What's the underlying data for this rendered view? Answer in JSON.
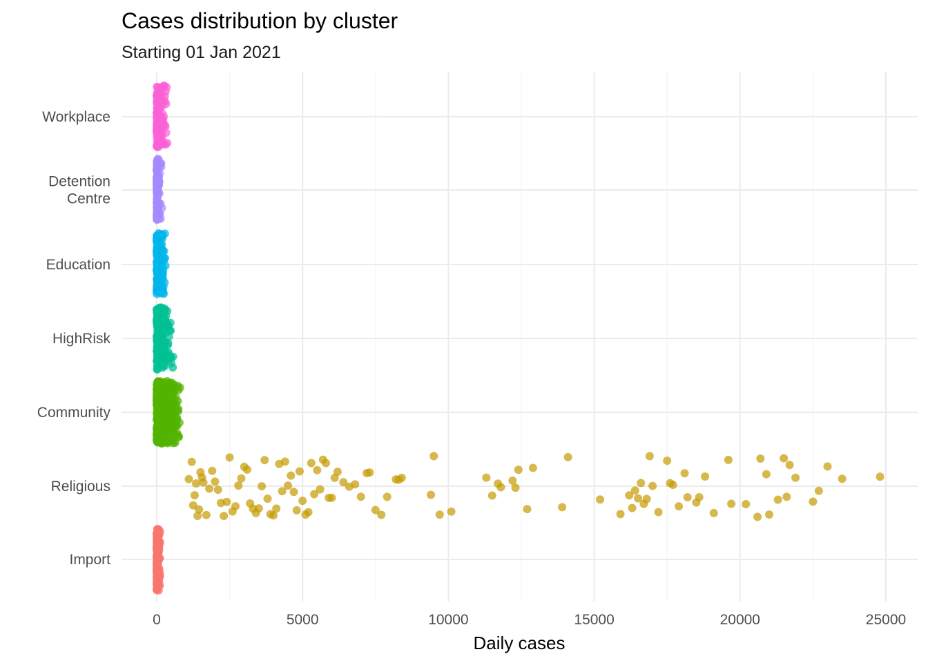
{
  "chart_data": {
    "type": "scatter",
    "subtype": "jitter-strip",
    "title": "Cases distribution by cluster",
    "subtitle": "Starting 01 Jan 2021",
    "xlabel": "Daily cases",
    "ylabel": "",
    "xlim": [
      -1200,
      26000
    ],
    "x_ticks": [
      0,
      5000,
      10000,
      15000,
      20000,
      25000
    ],
    "x_tick_labels": [
      "0",
      "5000",
      "10000",
      "15000",
      "20000",
      "25000"
    ],
    "x_minor_ticks": [
      2500,
      7500,
      12500,
      17500,
      22500
    ],
    "grid": true,
    "legend": "none",
    "categories": [
      "Import",
      "Religious",
      "Community",
      "HighRisk",
      "Education",
      "Detention\nCentre",
      "Workplace"
    ],
    "category_labels": [
      [
        "Import"
      ],
      [
        "Religious"
      ],
      [
        "Community"
      ],
      [
        "HighRisk"
      ],
      [
        "Education"
      ],
      [
        "Detention",
        "Centre"
      ],
      [
        "Workplace"
      ]
    ],
    "colors": {
      "Import": "#F8766D",
      "Religious": "#C49A00",
      "Community": "#53B400",
      "HighRisk": "#00C094",
      "Education": "#00B6EB",
      "Detention\nCentre": "#A58AFF",
      "Workplace": "#FB61D7"
    },
    "series": [
      {
        "name": "Import",
        "values": [
          0,
          5,
          10,
          15,
          20,
          30,
          40,
          50,
          60,
          70,
          80,
          90,
          100,
          110,
          120,
          2,
          8,
          25,
          35,
          45,
          55,
          65,
          75,
          85,
          95,
          105,
          115,
          12,
          18,
          28
        ]
      },
      {
        "name": "Detention\nCentre",
        "values": [
          0,
          0,
          5,
          10,
          15,
          20,
          25,
          30,
          40,
          50,
          60,
          70,
          80,
          90,
          100,
          110,
          120,
          150,
          180,
          3,
          7,
          12
        ]
      },
      {
        "name": "Education",
        "values": [
          0,
          20,
          40,
          60,
          80,
          100,
          120,
          140,
          160,
          180,
          200,
          220,
          240,
          260,
          280,
          300,
          10,
          30,
          50,
          70,
          90,
          110,
          130,
          150,
          170,
          190,
          210,
          230,
          250,
          270
        ]
      },
      {
        "name": "HighRisk",
        "values": [
          0,
          30,
          60,
          90,
          120,
          150,
          180,
          210,
          240,
          270,
          300,
          330,
          360,
          400,
          450,
          500,
          560,
          15,
          45,
          75,
          105,
          135,
          165,
          195,
          225,
          255,
          285,
          315,
          345,
          380,
          420,
          470
        ]
      },
      {
        "name": "Community",
        "values": [
          0,
          40,
          80,
          120,
          160,
          200,
          240,
          280,
          320,
          360,
          400,
          440,
          480,
          520,
          560,
          600,
          640,
          680,
          720,
          760,
          800,
          20,
          60,
          100,
          140,
          180,
          220,
          260,
          300,
          340,
          380,
          420,
          460,
          500,
          540,
          580,
          620,
          660,
          700,
          740,
          780,
          50,
          150,
          250,
          350,
          450,
          550,
          650,
          750,
          90,
          190,
          290,
          390,
          490,
          590,
          690
        ]
      },
      {
        "name": "Religious",
        "values": [
          1100,
          1200,
          1250,
          1300,
          1350,
          1400,
          1450,
          1500,
          1550,
          1600,
          1700,
          1800,
          1900,
          2000,
          2100,
          2200,
          2300,
          2400,
          2500,
          2600,
          2700,
          2800,
          2900,
          3000,
          3100,
          3200,
          3300,
          3400,
          3500,
          3600,
          3700,
          3800,
          3900,
          4000,
          4100,
          4200,
          4300,
          4400,
          4500,
          4600,
          4700,
          4800,
          4900,
          5000,
          5100,
          5200,
          5300,
          5400,
          5500,
          5600,
          5700,
          5800,
          5900,
          6000,
          6100,
          6200,
          6400,
          6600,
          6800,
          7000,
          7200,
          7300,
          7500,
          7700,
          7900,
          8200,
          8300,
          8400,
          9400,
          9500,
          9700,
          10100,
          11300,
          11500,
          11700,
          11800,
          12200,
          12300,
          12400,
          12700,
          12900,
          13900,
          14100,
          15200,
          15900,
          16200,
          16300,
          16400,
          16500,
          16600,
          16700,
          16800,
          16900,
          17000,
          17200,
          17500,
          17600,
          17700,
          17900,
          18100,
          18200,
          18500,
          18600,
          18800,
          19100,
          19600,
          19700,
          20200,
          20600,
          20700,
          20900,
          21000,
          21300,
          21500,
          21600,
          21700,
          21900,
          22500,
          22700,
          23000,
          23500,
          24800
        ]
      },
      {
        "name": "Workplace",
        "values": [
          0,
          20,
          40,
          60,
          80,
          100,
          120,
          140,
          160,
          180,
          200,
          240,
          280,
          320,
          360,
          10,
          30,
          50,
          70,
          90,
          110,
          130,
          150,
          170,
          190,
          220,
          260,
          300,
          340
        ]
      }
    ]
  }
}
